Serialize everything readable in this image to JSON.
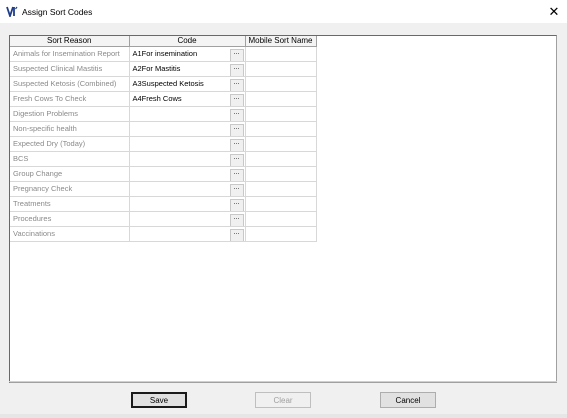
{
  "window": {
    "title": "Assign Sort Codes",
    "close_label": "✕"
  },
  "grid": {
    "columns": [
      "Sort Reason",
      "Code",
      "Mobile Sort Name"
    ],
    "ellipsis_label": "...",
    "rows": [
      {
        "reason": "Animals for Insemination Report",
        "code": "A1For insemination",
        "mobile": ""
      },
      {
        "reason": "Suspected Clinical Mastitis",
        "code": "A2For Mastitis",
        "mobile": ""
      },
      {
        "reason": "Suspected Ketosis (Combined)",
        "code": "A3Suspected Ketosis",
        "mobile": ""
      },
      {
        "reason": "Fresh Cows To Check",
        "code": "A4Fresh Cows",
        "mobile": ""
      },
      {
        "reason": "Digestion Problems",
        "code": "",
        "mobile": ""
      },
      {
        "reason": "Non-specific health",
        "code": "",
        "mobile": ""
      },
      {
        "reason": "Expected Dry (Today)",
        "code": "",
        "mobile": ""
      },
      {
        "reason": "BCS",
        "code": "",
        "mobile": ""
      },
      {
        "reason": "Group Change",
        "code": "",
        "mobile": ""
      },
      {
        "reason": "Pregnancy Check",
        "code": "",
        "mobile": ""
      },
      {
        "reason": "Treatments",
        "code": "",
        "mobile": ""
      },
      {
        "reason": "Procedures",
        "code": "",
        "mobile": ""
      },
      {
        "reason": "Vaccinations",
        "code": "",
        "mobile": ""
      }
    ]
  },
  "buttons": {
    "save": "Save",
    "clear": "Clear",
    "cancel": "Cancel"
  },
  "colors": {
    "title_bg": "#ffffff",
    "dialog_bg": "#f0f0f0",
    "icon_blue": "#1f3d8a",
    "disabled_text": "#a0a0a0"
  }
}
